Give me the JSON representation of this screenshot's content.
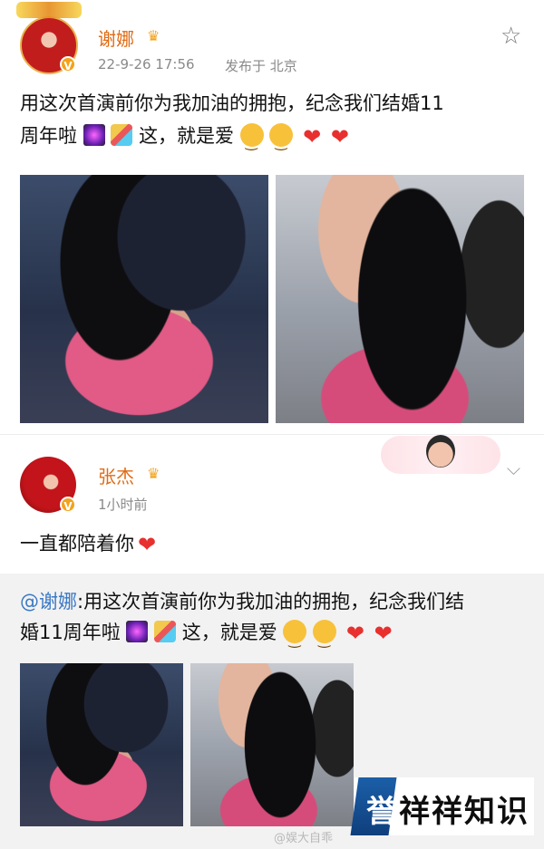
{
  "post": {
    "author": "谢娜",
    "timestamp": "22-9-26 17:56",
    "location": "发布于 北京",
    "text_line1": "用这次首演前你为我加油的拥抱，纪念我们结婚11",
    "text_line2_prefix": "周年啦",
    "text_line2_mid": "这，就是爱",
    "star_icon": "☆"
  },
  "comment": {
    "author": "张杰",
    "time": "1小时前",
    "text": "一直都陪着你",
    "chevron": "⌵"
  },
  "repost": {
    "mention": "@谢娜",
    "text_line1": ":用这次首演前你为我加油的拥抱，纪念我们结",
    "text_line2_prefix": "婚11周年啦",
    "text_line2_mid": "这，就是爱"
  },
  "watermark": "@娱大自乖",
  "logo": {
    "first_char": "誉",
    "rest": "祥祥知识"
  },
  "colors": {
    "name": "#e06b14",
    "meta": "#8a8a8a",
    "mention": "#3a78c3",
    "heart": "#e8302e",
    "logo_blue": "#1b5fa8"
  }
}
